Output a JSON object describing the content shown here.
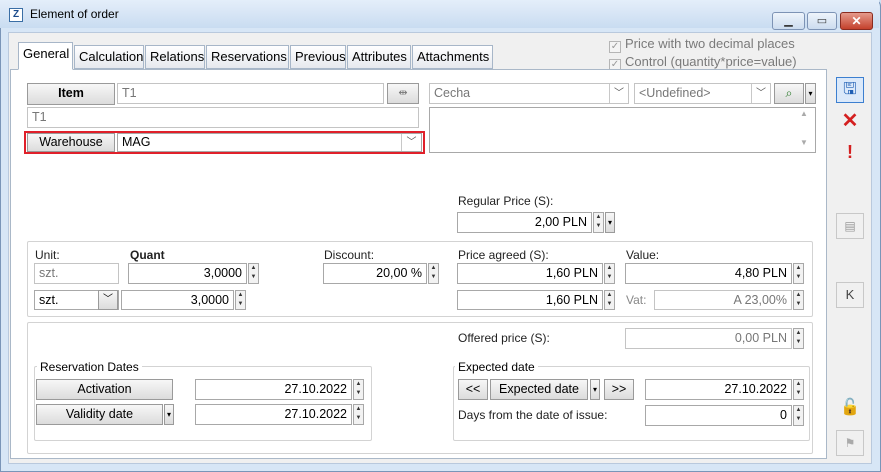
{
  "window": {
    "title": "Element of order",
    "app_icon": "Z"
  },
  "tabs": [
    "General",
    "Calculation",
    "Relations",
    "Reservations",
    "Previous",
    "Attributes",
    "Attachments"
  ],
  "options": {
    "price_two_decimals": "Price with two decimal places",
    "control": "Control (quantity*price=value)"
  },
  "item": {
    "button": "Item",
    "code": "T1",
    "name": "T1",
    "feature": "Cecha",
    "undefined_select": "<Undefined>"
  },
  "warehouse": {
    "button": "Warehouse",
    "value": "MAG"
  },
  "regular_price": {
    "label": "Regular Price (S):",
    "value": "2,00 PLN"
  },
  "unit": {
    "label": "Unit:",
    "value": "szt.",
    "select": "szt."
  },
  "quant": {
    "label": "Quant",
    "value1": "3,0000",
    "value2": "3,0000"
  },
  "discount": {
    "label": "Discount:",
    "value": "20,00 %"
  },
  "price_agreed": {
    "label": "Price agreed (S):",
    "value1": "1,60 PLN",
    "value2": "1,60 PLN"
  },
  "value": {
    "label": "Value:",
    "amount": "4,80 PLN",
    "vat_label": "Vat:",
    "vat": "A 23,00%"
  },
  "offered_price": {
    "label": "Offered price (S):",
    "value": "0,00 PLN"
  },
  "reservation": {
    "title": "Reservation Dates",
    "activation": "Activation",
    "activation_date": "27.10.2022",
    "validity": "Validity date",
    "validity_date": "27.10.2022"
  },
  "expected": {
    "title": "Expected date",
    "prev": "<<",
    "button": "Expected date",
    "next": ">>",
    "date": "27.10.2022",
    "days_label": "Days from the date of issue:",
    "days": "0"
  },
  "colors": {
    "highlight": "#e0202a",
    "accent": "#1f5fb5"
  }
}
